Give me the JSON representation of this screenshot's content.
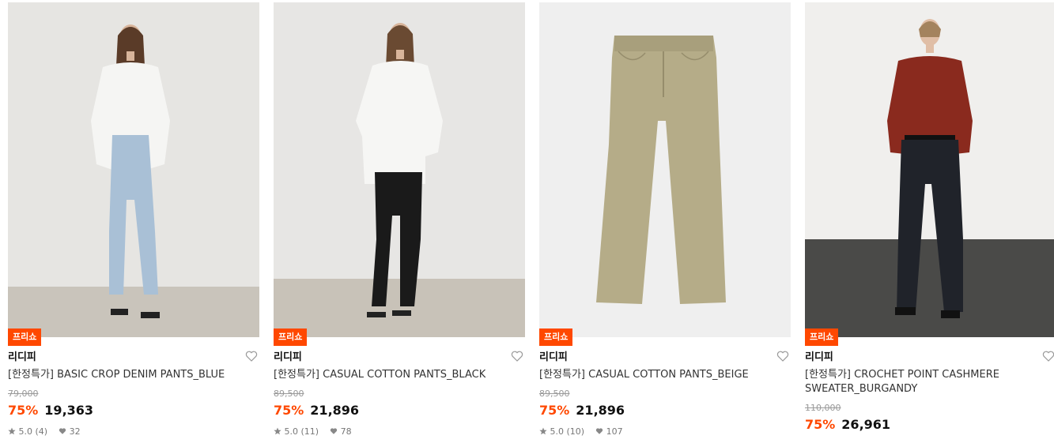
{
  "products": [
    {
      "badge": "프리쇼",
      "brand": "리디피",
      "name": "[한정특가] BASIC CROP DENIM PANTS_BLUE",
      "original_price": "79,000",
      "discount": "75%",
      "price": "19,363",
      "rating": "5.0",
      "reviews": "(4)",
      "likes": "32",
      "image": "model-white-shirt-blue-denim"
    },
    {
      "badge": "프리쇼",
      "brand": "리디피",
      "name": "[한정특가] CASUAL COTTON PANTS_BLACK",
      "original_price": "89,500",
      "discount": "75%",
      "price": "21,896",
      "rating": "5.0",
      "reviews": "(11)",
      "likes": "78",
      "image": "model-white-shirt-black-pants"
    },
    {
      "badge": "프리쇼",
      "brand": "리디피",
      "name": "[한정특가] CASUAL COTTON PANTS_BEIGE",
      "original_price": "89,500",
      "discount": "75%",
      "price": "21,896",
      "rating": "5.0",
      "reviews": "(10)",
      "likes": "107",
      "image": "beige-pants-flat"
    },
    {
      "badge": "프리쇼",
      "brand": "리디피",
      "name": "[한정특가] CROCHET POINT CASHMERE SWEATER_BURGANDY",
      "original_price": "110,000",
      "discount": "75%",
      "price": "26,961",
      "image": "model-burgundy-sweater"
    }
  ],
  "colors": {
    "accent": "#ff4800",
    "discount": "#ff4800"
  }
}
